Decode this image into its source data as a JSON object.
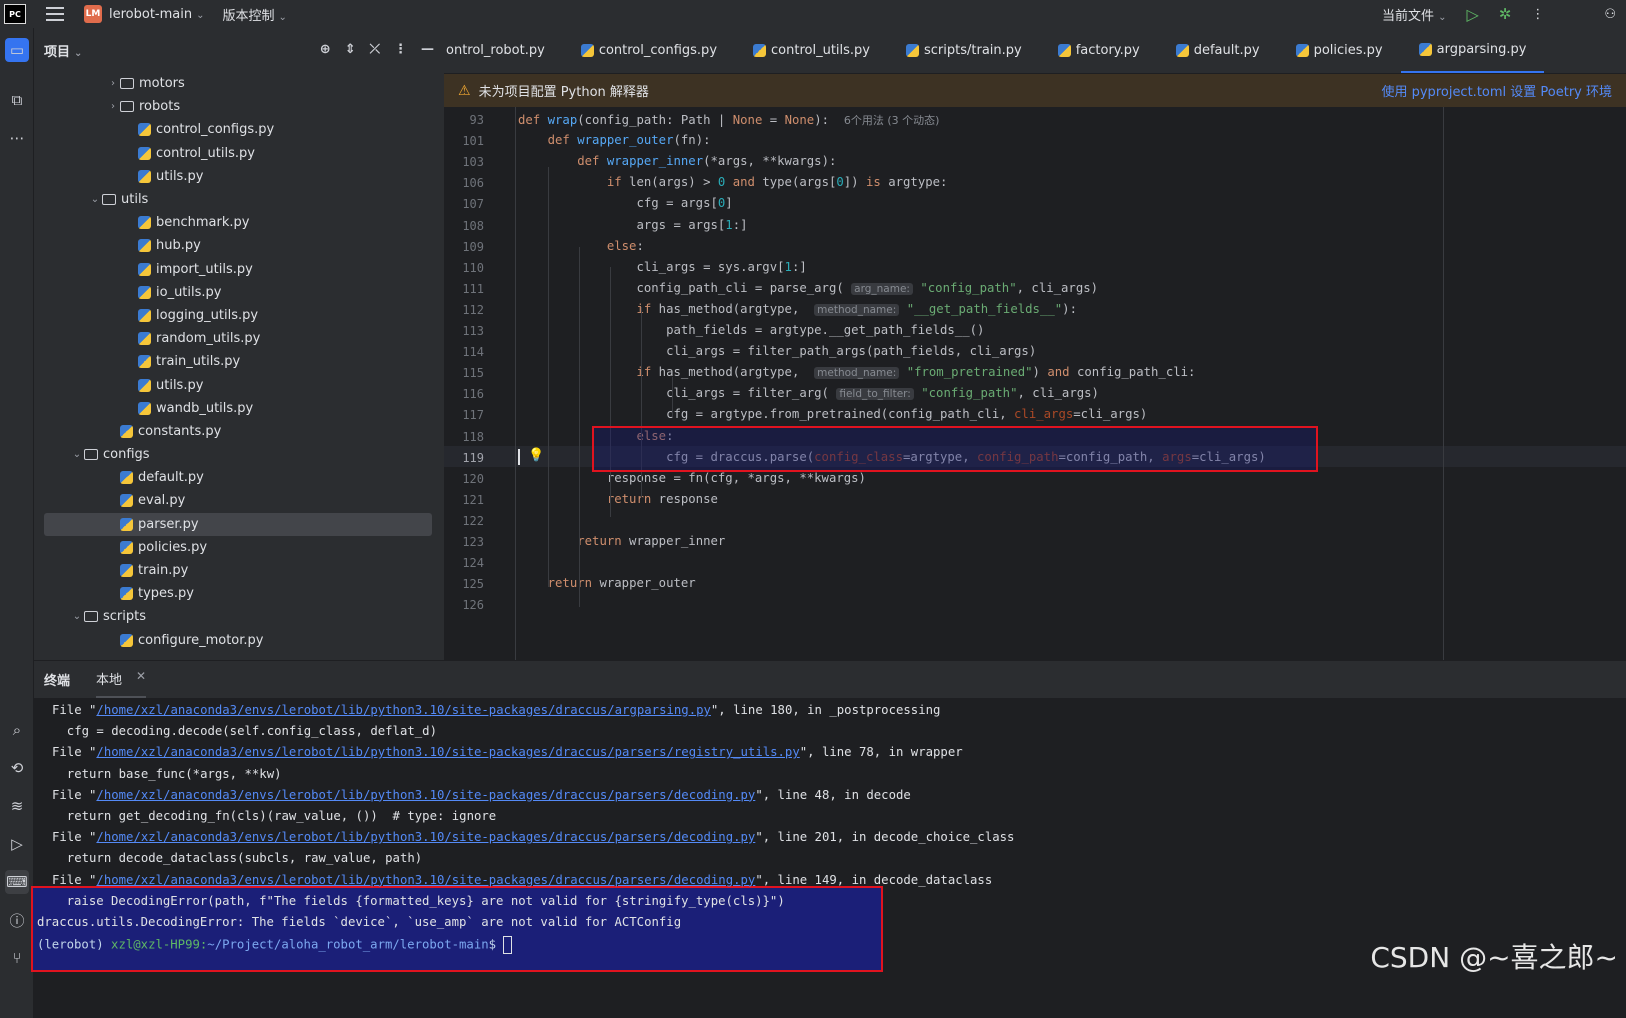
{
  "topbar": {
    "project_badge": "LM",
    "project_name": "lerobot-main",
    "vcs": "版本控制",
    "current_file": "当前文件"
  },
  "project_panel": {
    "title": "项目"
  },
  "tree": [
    {
      "name": "motors",
      "type": "folder",
      "depth": 4,
      "expanded": false
    },
    {
      "name": "robots",
      "type": "folder",
      "depth": 4,
      "expanded": false
    },
    {
      "name": "control_configs.py",
      "type": "py",
      "depth": 5
    },
    {
      "name": "control_utils.py",
      "type": "py",
      "depth": 5
    },
    {
      "name": "utils.py",
      "type": "py",
      "depth": 5
    },
    {
      "name": "utils",
      "type": "folder",
      "depth": 3,
      "expanded": true
    },
    {
      "name": "benchmark.py",
      "type": "py",
      "depth": 5
    },
    {
      "name": "hub.py",
      "type": "py",
      "depth": 5
    },
    {
      "name": "import_utils.py",
      "type": "py",
      "depth": 5
    },
    {
      "name": "io_utils.py",
      "type": "py",
      "depth": 5
    },
    {
      "name": "logging_utils.py",
      "type": "py",
      "depth": 5
    },
    {
      "name": "random_utils.py",
      "type": "py",
      "depth": 5
    },
    {
      "name": "train_utils.py",
      "type": "py",
      "depth": 5
    },
    {
      "name": "utils.py",
      "type": "py",
      "depth": 5
    },
    {
      "name": "wandb_utils.py",
      "type": "py",
      "depth": 5
    },
    {
      "name": "constants.py",
      "type": "py",
      "depth": 4
    },
    {
      "name": "configs",
      "type": "folder",
      "depth": 2,
      "expanded": true
    },
    {
      "name": "default.py",
      "type": "py",
      "depth": 4
    },
    {
      "name": "eval.py",
      "type": "py",
      "depth": 4
    },
    {
      "name": "parser.py",
      "type": "py",
      "depth": 4,
      "selected": true
    },
    {
      "name": "policies.py",
      "type": "py",
      "depth": 4
    },
    {
      "name": "train.py",
      "type": "py",
      "depth": 4
    },
    {
      "name": "types.py",
      "type": "py",
      "depth": 4
    },
    {
      "name": "scripts",
      "type": "folder",
      "depth": 2,
      "expanded": true
    },
    {
      "name": "configure_motor.py",
      "type": "py",
      "depth": 4
    }
  ],
  "editor_tabs": [
    "control_robot.py",
    "control_configs.py",
    "control_utils.py",
    "scripts/train.py",
    "factory.py",
    "default.py",
    "policies.py",
    "argparsing.py"
  ],
  "active_tab": "argparsing.py",
  "warning": {
    "message": "未为项目配置 Python 解释器",
    "action": "使用 pyproject.toml 设置 Poetry 环境"
  },
  "code_lines": [
    {
      "n": "93",
      "h": "<span class='kw'>def</span> <span class='fn'>wrap</span>(config_path: Path | <span class='kw'>None</span> = <span class='kw'>None</span>):  <span class='dim'>6个用法 (3 个动态)</span>"
    },
    {
      "n": "101",
      "h": "    <span class='kw'>def</span> <span class='fn'>wrapper_outer</span>(fn):"
    },
    {
      "n": "103",
      "h": "        <span class='kw'>def</span> <span class='fn'>wrapper_inner</span>(*args, **kwargs):"
    },
    {
      "n": "106",
      "h": "            <span class='kw'>if</span> len(args) > <span class='num'>0</span> <span class='kw'>and</span> type(args[<span class='num'>0</span>]) <span class='kw'>is</span> argtype:"
    },
    {
      "n": "107",
      "h": "                cfg = args[<span class='num'>0</span>]"
    },
    {
      "n": "108",
      "h": "                args = args[<span class='num'>1</span>:]"
    },
    {
      "n": "109",
      "h": "            <span class='kw'>else</span>:"
    },
    {
      "n": "110",
      "h": "                cli_args = sys.argv[<span class='num'>1</span>:]"
    },
    {
      "n": "111",
      "h": "                config_path_cli = parse_arg( <span class='hint'>arg_name:</span> <span class='str'>\"config_path\"</span>, cli_args)"
    },
    {
      "n": "112",
      "h": "                <span class='kw'>if</span> has_method(argtype,  <span class='hint'>method_name:</span> <span class='str'>\"__get_path_fields__\"</span>):"
    },
    {
      "n": "113",
      "h": "                    path_fields = argtype.__get_path_fields__()"
    },
    {
      "n": "114",
      "h": "                    cli_args = filter_path_args(path_fields, cli_args)"
    },
    {
      "n": "115",
      "h": "                <span class='kw'>if</span> has_method(argtype,  <span class='hint'>method_name:</span> <span class='str'>\"from_pretrained\"</span>) <span class='kw'>and</span> config_path_cli:"
    },
    {
      "n": "116",
      "h": "                    cli_args = filter_arg( <span class='hint'>field_to_filter:</span> <span class='str'>\"config_path\"</span>, cli_args)"
    },
    {
      "n": "117",
      "h": "                    cfg = argtype.from_pretrained(config_path_cli, <span class='prm'>cli_args</span>=cli_args)"
    },
    {
      "n": "118",
      "h": "                <span class='kw'>else</span>:"
    },
    {
      "n": "119",
      "h": "                    cfg = draccus.parse(<span class='prm'>config_class</span>=argtype, <span class='prm'>config_path</span>=config_path, <span class='prm'>args</span>=cli_args)"
    },
    {
      "n": "120",
      "h": "            response = fn(cfg, *args, **kwargs)"
    },
    {
      "n": "121",
      "h": "            <span class='kw'>return</span> response"
    },
    {
      "n": "122",
      "h": ""
    },
    {
      "n": "123",
      "h": "        <span class='kw'>return</span> wrapper_inner"
    },
    {
      "n": "124",
      "h": ""
    },
    {
      "n": "125",
      "h": "    <span class='kw'>return</span> wrapper_outer"
    },
    {
      "n": "126",
      "h": ""
    }
  ],
  "terminal": {
    "tab_label": "终端",
    "session_label": "本地",
    "lines": [
      {
        "pre": "File \"",
        "link": "/home/xzl/anaconda3/envs/lerobot/lib/python3.10/site-packages/draccus/argparsing.py",
        "post": "\", line 180, in _postprocessing"
      },
      {
        "pre": "  cfg = decoding.decode(self.config_class, deflat_d)",
        "link": "",
        "post": ""
      },
      {
        "pre": "File \"",
        "link": "/home/xzl/anaconda3/envs/lerobot/lib/python3.10/site-packages/draccus/parsers/registry_utils.py",
        "post": "\", line 78, in wrapper"
      },
      {
        "pre": "  return base_func(*args, **kw)",
        "link": "",
        "post": ""
      },
      {
        "pre": "File \"",
        "link": "/home/xzl/anaconda3/envs/lerobot/lib/python3.10/site-packages/draccus/parsers/decoding.py",
        "post": "\", line 48, in decode"
      },
      {
        "pre": "  return get_decoding_fn(cls)(raw_value, ())  # type: ignore",
        "link": "",
        "post": ""
      },
      {
        "pre": "File \"",
        "link": "/home/xzl/anaconda3/envs/lerobot/lib/python3.10/site-packages/draccus/parsers/decoding.py",
        "post": "\", line 201, in decode_choice_class"
      },
      {
        "pre": "  return decode_dataclass(subcls, raw_value, path)",
        "link": "",
        "post": ""
      },
      {
        "pre": "File \"",
        "link": "/home/xzl/anaconda3/envs/lerobot/lib/python3.10/site-packages/draccus/parsers/decoding.py",
        "post": "\", line 149, in decode_dataclass"
      }
    ],
    "error_lines": [
      "    raise DecodingError(path, f\"The fields {formatted_keys} are not valid for {stringify_type(cls)}\")",
      "draccus.utils.DecodingError: The fields `device`, `use_amp` are not valid for ACTConfig"
    ],
    "prompt_env": "(lerobot) ",
    "prompt_user": "xzl@xzl-HP99:",
    "prompt_path": "~/Project/aloha_robot_arm/lerobot-main",
    "prompt_sign": "$ "
  },
  "watermark": "CSDN @~喜之郎~"
}
